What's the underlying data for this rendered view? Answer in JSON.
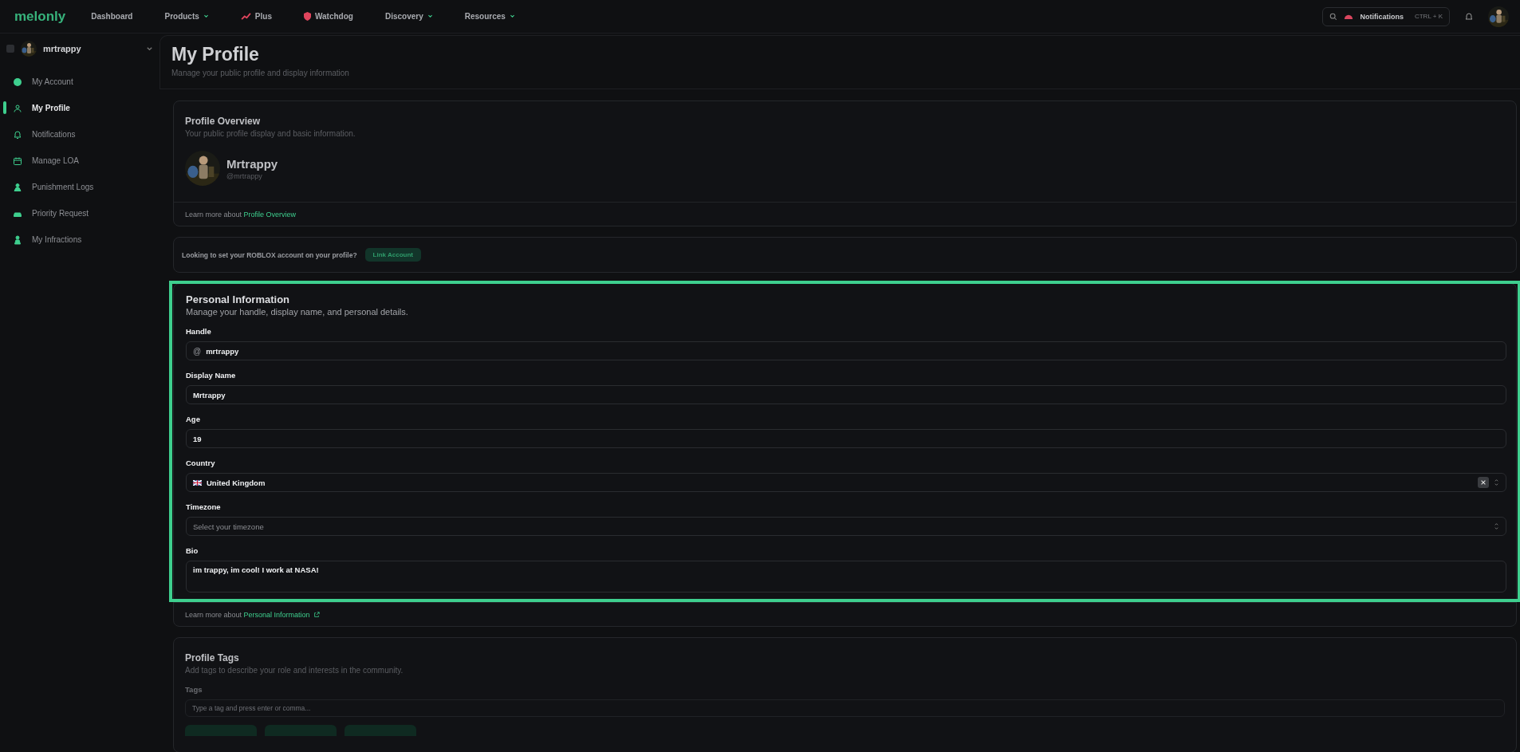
{
  "topbar": {
    "logo": "melonly",
    "nav": [
      {
        "kind": "link",
        "label": "Dashboard"
      },
      {
        "kind": "dropdown",
        "label": "Products"
      },
      {
        "kind": "trend",
        "label": "Plus"
      },
      {
        "kind": "shield",
        "label": "Watchdog"
      },
      {
        "kind": "dropdown",
        "label": "Discovery"
      },
      {
        "kind": "dropdown",
        "label": "Resources"
      }
    ],
    "search": {
      "label": "Notifications",
      "shortcut": "CTRL + K"
    }
  },
  "sidebar": {
    "user": "mrtrappy",
    "items": [
      {
        "label": "My Account",
        "selected": false
      },
      {
        "label": "My Profile",
        "selected": true
      },
      {
        "label": "Notifications",
        "selected": false
      },
      {
        "label": "Manage LOA",
        "selected": false
      },
      {
        "label": "Punishment Logs",
        "selected": false
      },
      {
        "label": "Priority Request",
        "selected": false
      },
      {
        "label": "My Infractions",
        "selected": false
      }
    ]
  },
  "header": {
    "title": "My Profile",
    "subtitle": "Manage your public profile and display information"
  },
  "profile_overview": {
    "title": "Profile Overview",
    "subtitle": "Your public profile display and basic information.",
    "display_name": "Mrtrappy",
    "handle": "@mrtrappy",
    "learn_more": "Learn more about",
    "link": "Profile Overview"
  },
  "roblox": {
    "text": "Looking to set your ROBLOX account on your profile?",
    "button": "Link Account"
  },
  "personal_information": {
    "highlighted": true,
    "title": "Personal Information",
    "subtitle": "Manage your handle, display name, and personal details.",
    "fields": [
      {
        "kind": "prefixed",
        "label": "Handle",
        "prefix": "@",
        "value": "mrtrappy"
      },
      {
        "kind": "text",
        "label": "Display Name",
        "value": "Mrtrappy"
      },
      {
        "kind": "text",
        "label": "Age",
        "value": "19"
      },
      {
        "kind": "select",
        "label": "Country",
        "value": "United Kingdom",
        "flag": true,
        "clearable": true
      },
      {
        "kind": "select",
        "label": "Timezone",
        "placeholder": "Select your timezone"
      },
      {
        "kind": "textarea",
        "label": "Bio",
        "value": "im trappy, im cool! I work at NASA!"
      }
    ],
    "learn_more": "Learn more about",
    "link": "Personal Information"
  },
  "profile_tags": {
    "title": "Profile Tags",
    "subtitle": "Add tags to describe your role and interests in the community.",
    "label": "Tags",
    "placeholder": "Type a tag and press enter or comma..."
  }
}
